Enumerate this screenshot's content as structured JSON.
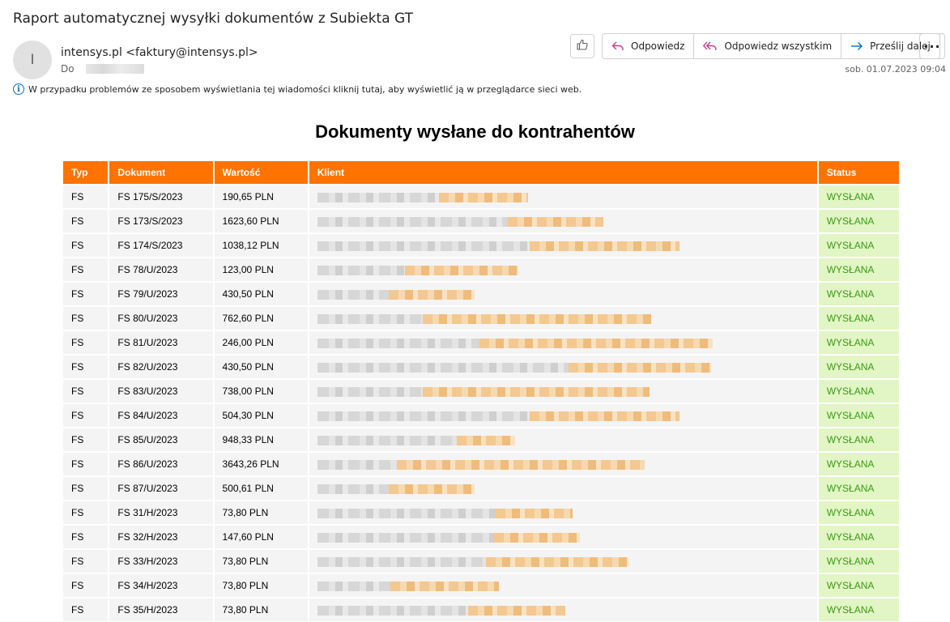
{
  "email": {
    "subject": "Raport automatycznej wysyłki dokumentów z Subiekta GT",
    "avatar_initial": "I",
    "sender": "intensys.pl <faktury@intensys.pl>",
    "to_label": "Do",
    "info_text": "W przypadku problemów ze sposobem wyświetlania tej wiadomości kliknij tutaj, aby wyświetlić ją w przeglądarce sieci web.",
    "date": "sob. 01.07.2023 09:04",
    "actions": {
      "reply": "Odpowiedz",
      "reply_all": "Odpowiedz wszystkim",
      "forward": "Prześlij dalej",
      "more": "···"
    },
    "accent_color": "#0f6cbd",
    "reply_icon_color": "#c43e8c",
    "forward_icon_color": "#0f6cbd"
  },
  "report": {
    "title": "Dokumenty wysłane do kontrahentów",
    "header_color": "#ff7300",
    "status_bg": "#e2f5c4",
    "status_color": "#3a9b16",
    "columns": [
      "Typ",
      "Dokument",
      "Wartość",
      "Klient",
      "Status"
    ],
    "rows": [
      {
        "typ": "FS",
        "dokument": "FS 175/S/2023",
        "wartosc": "190,65 PLN",
        "status": "WYSŁANA"
      },
      {
        "typ": "FS",
        "dokument": "FS 173/S/2023",
        "wartosc": "1623,60 PLN",
        "status": "WYSŁANA"
      },
      {
        "typ": "FS",
        "dokument": "FS 174/S/2023",
        "wartosc": "1038,12 PLN",
        "status": "WYSŁANA"
      },
      {
        "typ": "FS",
        "dokument": "FS 78/U/2023",
        "wartosc": "123,00 PLN",
        "status": "WYSŁANA"
      },
      {
        "typ": "FS",
        "dokument": "FS 79/U/2023",
        "wartosc": "430,50 PLN",
        "status": "WYSŁANA"
      },
      {
        "typ": "FS",
        "dokument": "FS 80/U/2023",
        "wartosc": "762,60 PLN",
        "status": "WYSŁANA"
      },
      {
        "typ": "FS",
        "dokument": "FS 81/U/2023",
        "wartosc": "246,00 PLN",
        "status": "WYSŁANA"
      },
      {
        "typ": "FS",
        "dokument": "FS 82/U/2023",
        "wartosc": "430,50 PLN",
        "status": "WYSŁANA"
      },
      {
        "typ": "FS",
        "dokument": "FS 83/U/2023",
        "wartosc": "738,00 PLN",
        "status": "WYSŁANA"
      },
      {
        "typ": "FS",
        "dokument": "FS 84/U/2023",
        "wartosc": "504,30 PLN",
        "status": "WYSŁANA"
      },
      {
        "typ": "FS",
        "dokument": "FS 85/U/2023",
        "wartosc": "948,33 PLN",
        "status": "WYSŁANA"
      },
      {
        "typ": "FS",
        "dokument": "FS 86/U/2023",
        "wartosc": "3643,26 PLN",
        "status": "WYSŁANA"
      },
      {
        "typ": "FS",
        "dokument": "FS 87/U/2023",
        "wartosc": "500,61 PLN",
        "status": "WYSŁANA"
      },
      {
        "typ": "FS",
        "dokument": "FS 31/H/2023",
        "wartosc": "73,80 PLN",
        "status": "WYSŁANA"
      },
      {
        "typ": "FS",
        "dokument": "FS 32/H/2023",
        "wartosc": "147,60 PLN",
        "status": "WYSŁANA"
      },
      {
        "typ": "FS",
        "dokument": "FS 33/H/2023",
        "wartosc": "73,80 PLN",
        "status": "WYSŁANA"
      },
      {
        "typ": "FS",
        "dokument": "FS 34/H/2023",
        "wartosc": "73,80 PLN",
        "status": "WYSŁANA"
      },
      {
        "typ": "FS",
        "dokument": "FS 35/H/2023",
        "wartosc": "73,80 PLN",
        "status": "WYSŁANA"
      }
    ]
  }
}
